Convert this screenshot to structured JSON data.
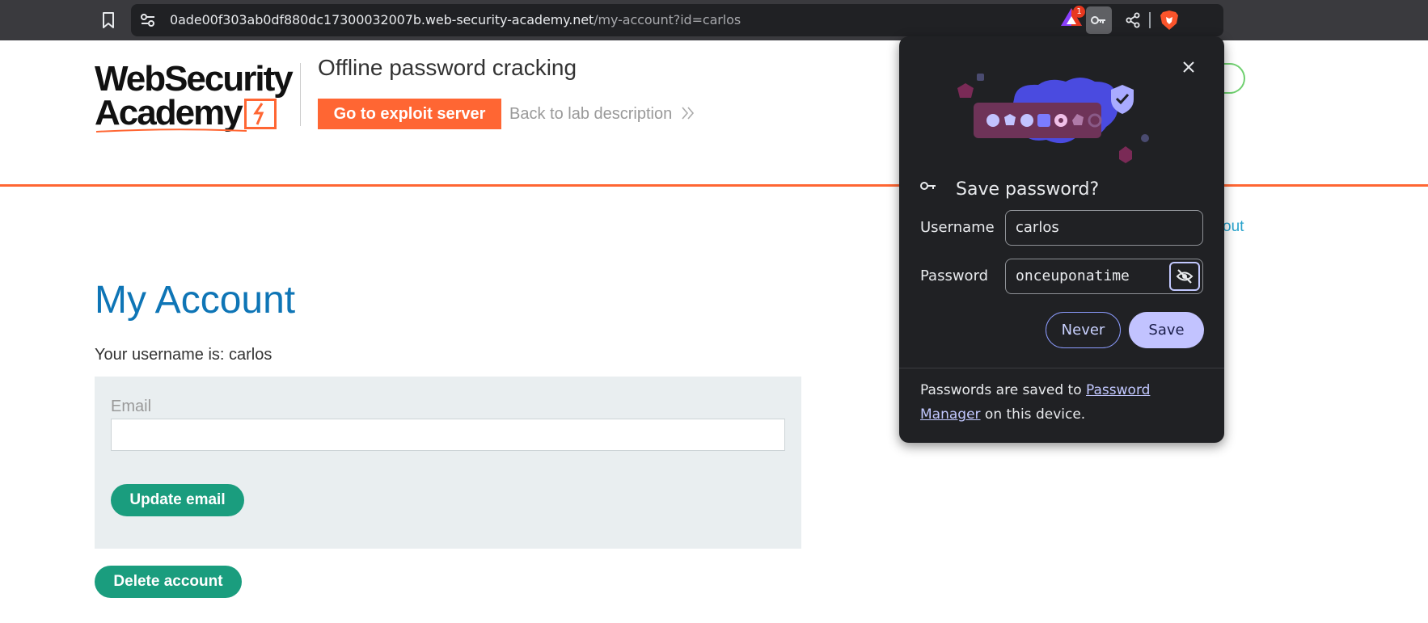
{
  "browser": {
    "url_host": "0ade00f303ab0df880dc17300032007b.web-security-academy.net",
    "url_path": "/my-account?id=carlos",
    "notification_count": "1"
  },
  "header": {
    "logo_line1": "WebSecurity",
    "logo_line2": "Academy",
    "lab_title": "Offline password cracking",
    "exploit_button": "Go to exploit server",
    "back_link": "Back to lab description",
    "logout_fragment": "out"
  },
  "account": {
    "heading": "My Account",
    "username_line": "Your username is: carlos",
    "email_label": "Email",
    "email_value": "",
    "update_button": "Update email",
    "delete_button": "Delete account"
  },
  "password_popup": {
    "title": "Save password?",
    "username_label": "Username",
    "username_value": "carlos",
    "password_label": "Password",
    "password_value": "onceuponatime",
    "never_button": "Never",
    "save_button": "Save",
    "footer_prefix": "Passwords are saved to ",
    "footer_link": "Password Manager",
    "footer_suffix": " on this device."
  },
  "colors": {
    "brand_orange": "#ff6633",
    "heading_blue": "#0e75b6",
    "button_green": "#1a9d7e",
    "popup_bg": "#202124",
    "popup_accent": "#c2c3ff"
  }
}
